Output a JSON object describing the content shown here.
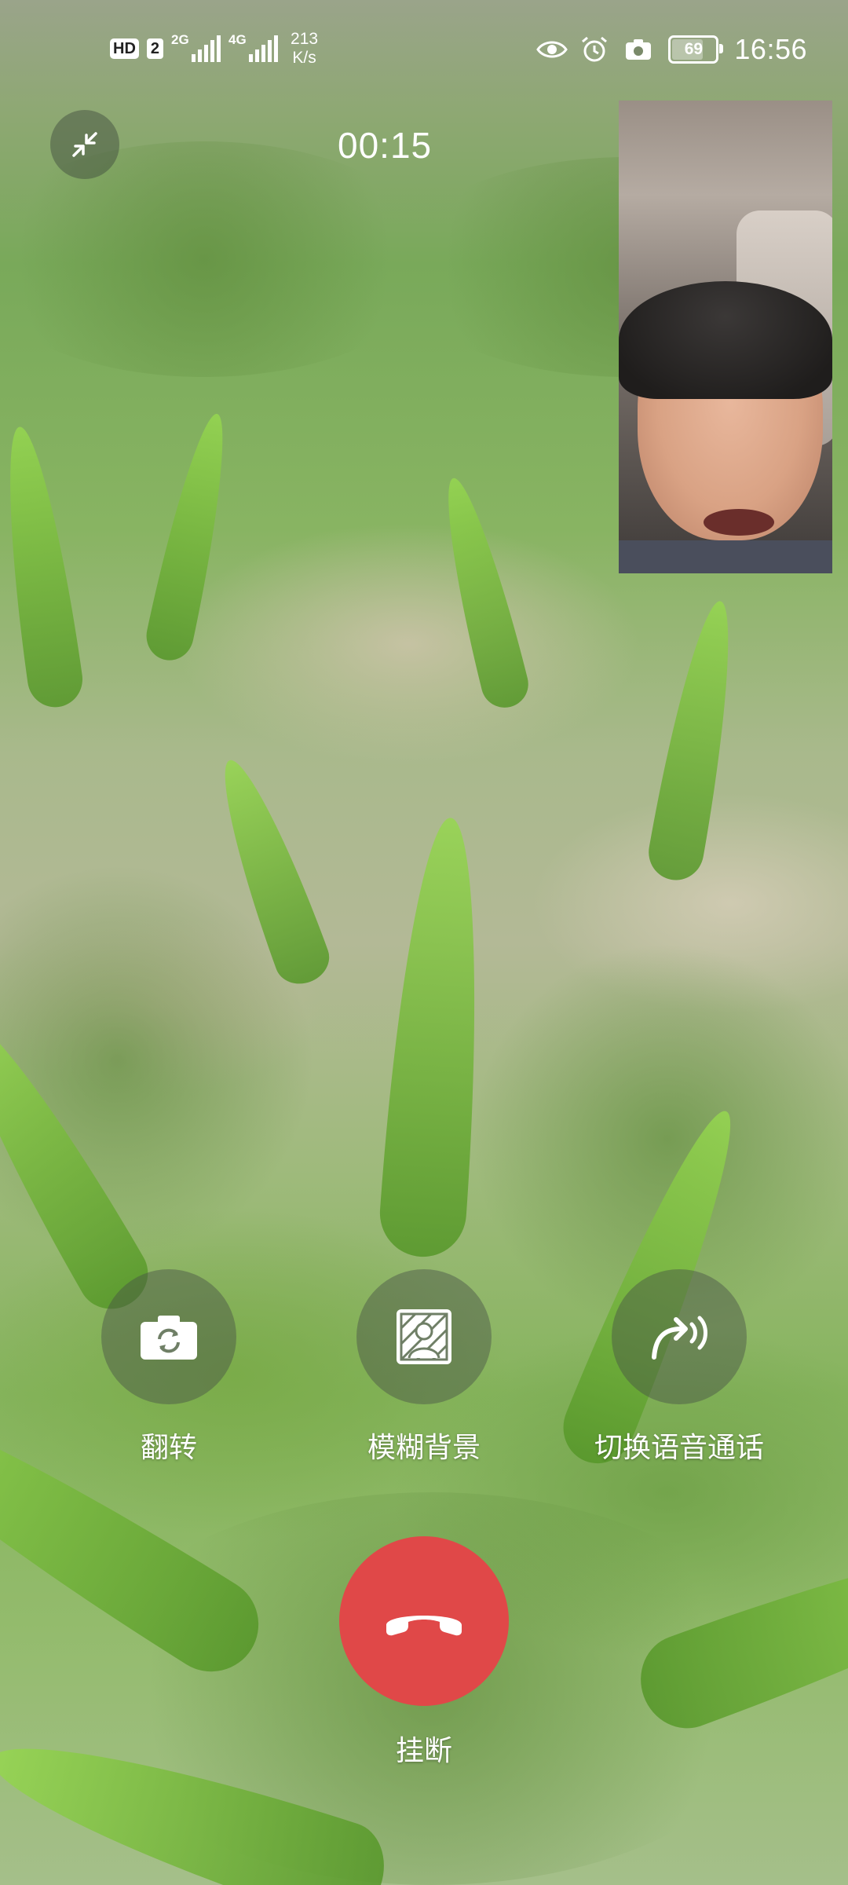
{
  "status_bar": {
    "hd": "HD",
    "sim": "2",
    "net1": "2G",
    "net2": "4G",
    "speed_value": "213",
    "speed_unit": "K/s",
    "battery": "69",
    "time": "16:56",
    "icons": [
      "eye-icon",
      "alarm-icon",
      "camera-icon"
    ]
  },
  "call": {
    "timer": "00:15"
  },
  "actions": {
    "flip": {
      "label": "翻转",
      "icon": "flip-camera-icon"
    },
    "blur": {
      "label": "模糊背景",
      "icon": "blur-background-icon"
    },
    "voice": {
      "label": "切换语音通话",
      "icon": "switch-voice-icon"
    }
  },
  "hangup": {
    "label": "挂断",
    "icon": "hang-up-icon",
    "color": "#e04848"
  }
}
